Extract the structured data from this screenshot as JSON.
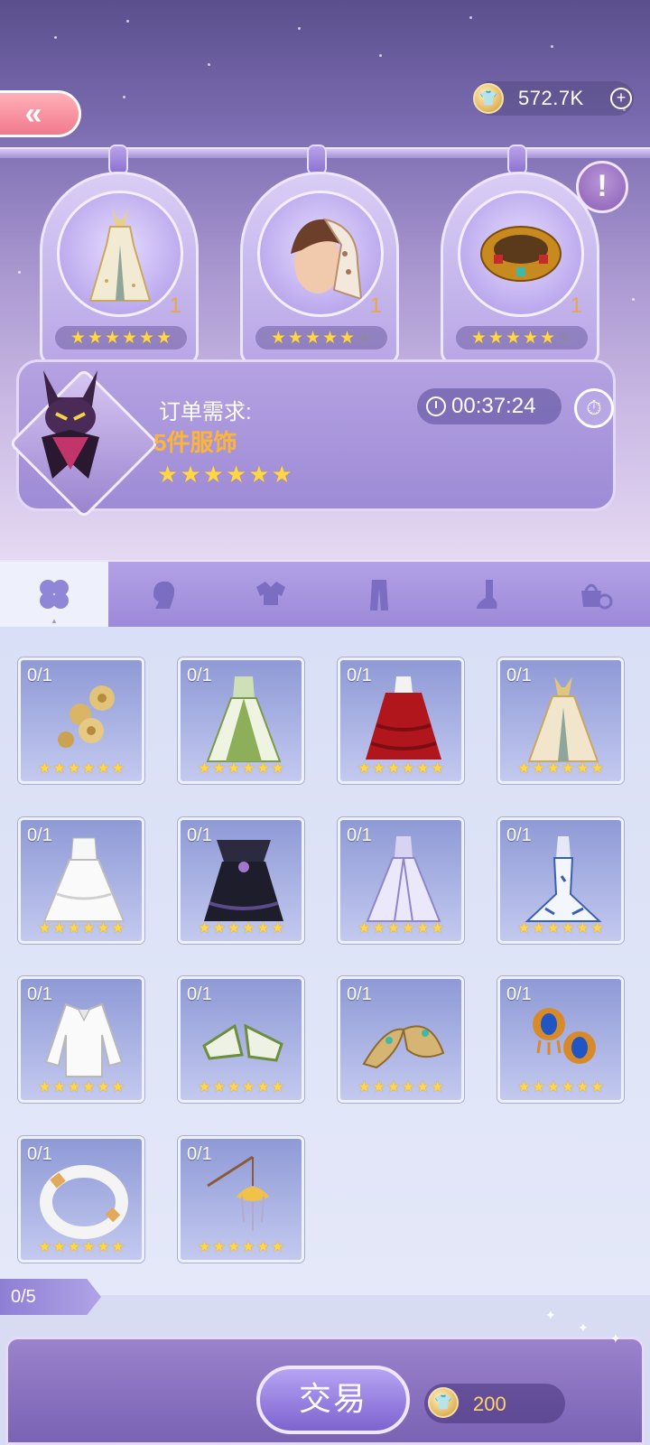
{
  "header": {
    "back_label": "«",
    "currency_value": "572.7K",
    "plus_label": "+",
    "info_label": "!"
  },
  "request_items": [
    {
      "icon": "gown-icon",
      "count": "1",
      "stars": 6,
      "max_stars": 6
    },
    {
      "icon": "headscarf-hairstyle-icon",
      "count": "1",
      "stars": 5,
      "max_stars": 6
    },
    {
      "icon": "gold-ring-icon",
      "count": "1",
      "stars": 5,
      "max_stars": 6
    }
  ],
  "order": {
    "label": "订单需求:",
    "value": "5件服饰",
    "stars": 6,
    "timer": "00:37:24"
  },
  "tabs": [
    {
      "name": "all",
      "icon": "clover-icon",
      "active": true
    },
    {
      "name": "hair",
      "icon": "head-silhouette-icon",
      "active": false
    },
    {
      "name": "top",
      "icon": "blouse-icon",
      "active": false
    },
    {
      "name": "bottom",
      "icon": "pants-icon",
      "active": false
    },
    {
      "name": "shoes",
      "icon": "foot-icon",
      "active": false
    },
    {
      "name": "accessory",
      "icon": "bag-ring-icon",
      "active": false
    }
  ],
  "items": [
    {
      "count": "0/1",
      "icon": "gold-flower-hairpin-icon",
      "stars": 6
    },
    {
      "count": "0/1",
      "icon": "green-gown-icon",
      "stars": 6
    },
    {
      "count": "0/1",
      "icon": "red-ruffle-gown-icon",
      "stars": 6
    },
    {
      "count": "0/1",
      "icon": "gold-jeweled-gown-icon",
      "stars": 6
    },
    {
      "count": "0/1",
      "icon": "white-wedding-gown-icon",
      "stars": 6
    },
    {
      "count": "0/1",
      "icon": "black-gothic-gown-icon",
      "stars": 6
    },
    {
      "count": "0/1",
      "icon": "lavender-gown-icon",
      "stars": 6
    },
    {
      "count": "0/1",
      "icon": "blue-white-mermaid-gown-icon",
      "stars": 6
    },
    {
      "count": "0/1",
      "icon": "white-blouse-icon",
      "stars": 6
    },
    {
      "count": "0/1",
      "icon": "green-heels-icon",
      "stars": 6
    },
    {
      "count": "0/1",
      "icon": "gold-flats-icon",
      "stars": 6
    },
    {
      "count": "0/1",
      "icon": "sapphire-earrings-icon",
      "stars": 6
    },
    {
      "count": "0/1",
      "icon": "white-gold-bangle-icon",
      "stars": 6
    },
    {
      "count": "0/1",
      "icon": "lotus-lantern-icon",
      "stars": 6
    }
  ],
  "progress": "0/5",
  "trade": {
    "label": "交易",
    "cost": "200"
  },
  "colors": {
    "star_on": "#ffd54a",
    "star_off": "#8e86a8",
    "order_value": "#ffb534",
    "count_gold": "#e8a54c"
  }
}
